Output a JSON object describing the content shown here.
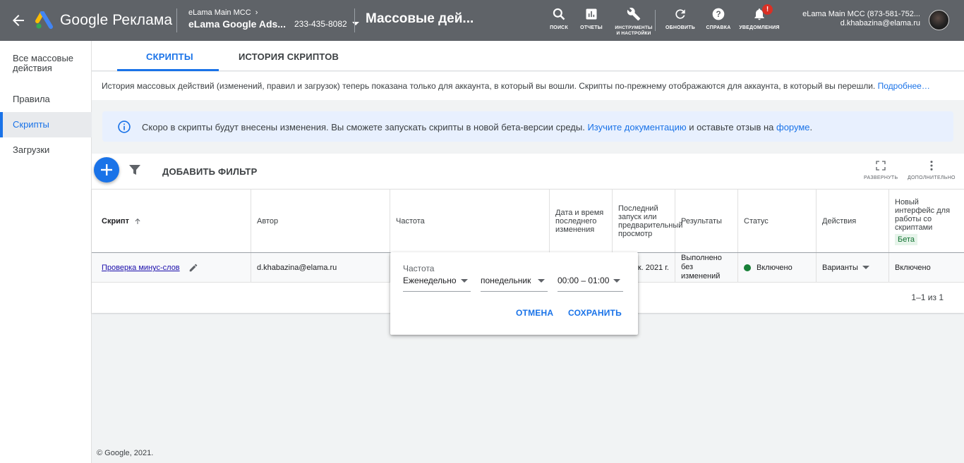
{
  "header": {
    "logo_text": "Google Реклама",
    "account_parent": "eLama Main MCC",
    "account_name": "eLama Google Ads...",
    "account_id": "233-435-8082",
    "page_title": "Массовые дей...",
    "tools": [
      {
        "label": "ПОИСК",
        "icon": "search-icon"
      },
      {
        "label": "ОТЧЕТЫ",
        "icon": "reports-icon"
      },
      {
        "label": "ИНСТРУМЕНТЫ И НАСТРОЙКИ",
        "icon": "wrench-icon"
      },
      {
        "label": "ОБНОВИТЬ",
        "icon": "refresh-icon"
      },
      {
        "label": "СПРАВКА",
        "icon": "help-icon"
      },
      {
        "label": "УВЕДОМЛЕНИЯ",
        "icon": "bell-icon",
        "badge": "!"
      }
    ],
    "user_account": "eLama Main MCC (873-581-752...",
    "user_email": "d.khabazina@elama.ru",
    "colors": {
      "bar": "#5f6368",
      "accent": "#1a73e8"
    }
  },
  "sidebar": {
    "items": [
      {
        "label": "Все массовые действия",
        "active": false
      },
      {
        "label": "Правила",
        "active": false
      },
      {
        "label": "Скрипты",
        "active": true
      },
      {
        "label": "Загрузки",
        "active": false
      }
    ]
  },
  "tabs": [
    {
      "label": "СКРИПТЫ",
      "active": true
    },
    {
      "label": "ИСТОРИЯ СКРИПТОВ",
      "active": false
    }
  ],
  "infobar": {
    "text": "История массовых действий (изменений, правил и загрузок) теперь показана только для аккаунта, в который вы вошли. Скрипты по-прежнему отображаются для аккаунта, в который вы перешли.",
    "link": "Подробнее…"
  },
  "banner": {
    "text1": "Скоро в скрипты будут внесены изменения. Вы сможете запускать скрипты в новой бета-версии среды.",
    "link1": "Изучите документацию",
    "text2": "и оставьте отзыв на",
    "link2": "форуме",
    "text3": "."
  },
  "toolbar": {
    "add_filter": "ДОБАВИТЬ ФИЛЬТР",
    "expand": "РАЗВЕРНУТЬ",
    "more": "ДОПОЛНИТЕЛЬНО"
  },
  "table": {
    "headers": {
      "script": "Скрипт",
      "author": "Автор",
      "frequency": "Частота",
      "modified": "Дата и время последнего изменения",
      "last_run": "Последний запуск или предварительный просмотр",
      "results": "Результаты",
      "status": "Статус",
      "actions": "Действия",
      "new_ui": "Новый интерфейс для работы со скриптами",
      "beta": "Бета"
    },
    "row": {
      "script": "Проверка минус-слов",
      "author": "d.khabazina@elama.ru",
      "last_run": "к. 2021 г.",
      "results": "Выполнено без изменений",
      "status": "Включено",
      "actions": "Варианты",
      "new_ui": "Включено"
    },
    "pagination": "1–1 из 1"
  },
  "popup": {
    "label": "Частота",
    "frequency": "Еженедельно",
    "day": "понедельник",
    "time": "00:00 – 01:00",
    "cancel": "ОТМЕНА",
    "save": "СОХРАНИТЬ"
  },
  "footer": "© Google, 2021."
}
